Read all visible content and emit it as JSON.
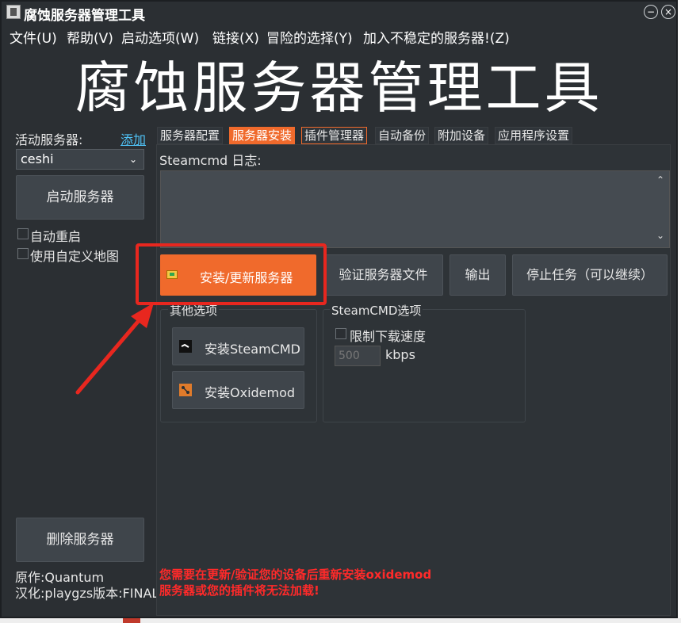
{
  "window": {
    "title": "腐蚀服务器管理工具",
    "minimize_glyph": "−",
    "close_glyph": "×"
  },
  "menu": [
    "文件(U)",
    "帮助(V)",
    "启动选项(W)",
    "链接(X)",
    "冒险的选择(Y)",
    "加入不稳定的服务器!(Z)"
  ],
  "banner": "腐蚀服务器管理工具",
  "sidebar": {
    "active_label": "活动服务器:",
    "add_link": "添加",
    "server_selected": "ceshi",
    "start_button": "启动服务器",
    "auto_restart": "自动重启",
    "custom_map": "使用自定义地图",
    "delete_button": "删除服务器",
    "credit_original": "原作:Quantum",
    "credit_translation": "汉化:playgzs版本:FINAL"
  },
  "tabs": [
    {
      "label": "服务器配置"
    },
    {
      "label": "服务器安装"
    },
    {
      "label": "插件管理器"
    },
    {
      "label": "自动备份"
    },
    {
      "label": "附加设备"
    },
    {
      "label": "应用程序设置"
    }
  ],
  "install": {
    "log_label": "Steamcmd 日志:",
    "install_update_button": "安装/更新服务器",
    "verify_button": "验证服务器文件",
    "output_button": "输出",
    "stop_button": "停止任务（可以继续）",
    "other_options_title": "其他选项",
    "install_steamcmd": "安装SteamCMD",
    "install_oxidemod": "安装Oxidemod",
    "steamcmd_options_title": "SteamCMD选项",
    "limit_speed": "限制下载速度",
    "speed_value": "500",
    "speed_unit": "kbps",
    "warning_line1": "您需要在更新/验证您的设备后重新安装oxidemod",
    "warning_line2": "服务器或您的插件将无法加载!"
  },
  "colors": {
    "accent": "#f06a2c",
    "annotation_red": "#e8271f",
    "warning": "#ff2a2a",
    "link": "#4fc3f7"
  }
}
